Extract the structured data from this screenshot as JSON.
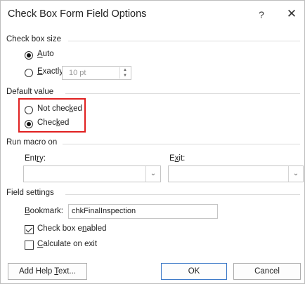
{
  "window": {
    "title": "Check Box Form Field Options",
    "help_glyph": "?",
    "close_glyph": "✕"
  },
  "check_box_size": {
    "heading": "Check box size",
    "auto": {
      "first": "A",
      "rest": "uto",
      "selected": true
    },
    "exactly": {
      "first": "E",
      "rest": "xactly:",
      "selected": false
    },
    "exact_value": "10 pt"
  },
  "default_value": {
    "heading": "Default value",
    "not_checked": {
      "pre": "Not chec",
      "key": "k",
      "post": "ed",
      "selected": false
    },
    "checked": {
      "pre": "Chec",
      "key": "k",
      "post": "ed",
      "selected": true
    },
    "highlight_color": "#e02020"
  },
  "run_macro": {
    "heading": "Run macro on",
    "entry": {
      "pre": "Ent",
      "key": "r",
      "post": "y:",
      "value": ""
    },
    "exit": {
      "pre": "E",
      "key": "x",
      "post": "it:",
      "value": ""
    }
  },
  "field_settings": {
    "heading": "Field settings",
    "bookmark": {
      "key": "B",
      "post": "ookmark:",
      "value": "chkFinalInspection"
    },
    "enabled": {
      "pre": "Check box e",
      "key": "n",
      "post": "abled",
      "checked": true
    },
    "calculate": {
      "key": "C",
      "post": "alculate on exit",
      "checked": false
    }
  },
  "buttons": {
    "add_help": {
      "pre": "Add Help ",
      "key": "T",
      "post": "ext..."
    },
    "ok": "OK",
    "cancel": "Cancel"
  },
  "icons": {
    "dropdown": "chevron-down-icon",
    "spin": "spinner-arrows-icon"
  },
  "colors": {
    "accent_border": "#3b78c7"
  }
}
